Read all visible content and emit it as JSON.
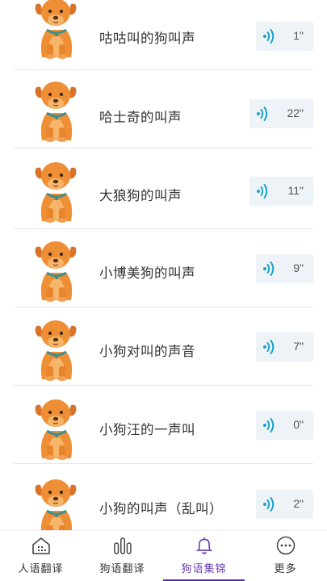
{
  "sounds": [
    {
      "title": "咕咕叫的狗叫声",
      "duration": "1\""
    },
    {
      "title": "哈士奇的叫声",
      "duration": "22\""
    },
    {
      "title": "大狼狗的叫声",
      "duration": "11\""
    },
    {
      "title": "小博美狗的叫声",
      "duration": "9\""
    },
    {
      "title": "小狗对叫的声音",
      "duration": "7\""
    },
    {
      "title": "小狗汪的一声叫",
      "duration": "0\""
    },
    {
      "title": "小狗的叫声（乱叫）",
      "duration": "2\""
    }
  ],
  "tabs": [
    {
      "label": "人语翻译",
      "icon": "house-icon"
    },
    {
      "label": "狗语翻译",
      "icon": "sound-bars-icon"
    },
    {
      "label": "狗语集锦",
      "icon": "bell-icon",
      "active": true
    },
    {
      "label": "更多",
      "icon": "more-icon"
    }
  ],
  "colors": {
    "accent": "#6a3fb0",
    "wave": "#1aa3c8",
    "voice_bg": "#eef3f8",
    "dog_body": "#f0953a"
  }
}
